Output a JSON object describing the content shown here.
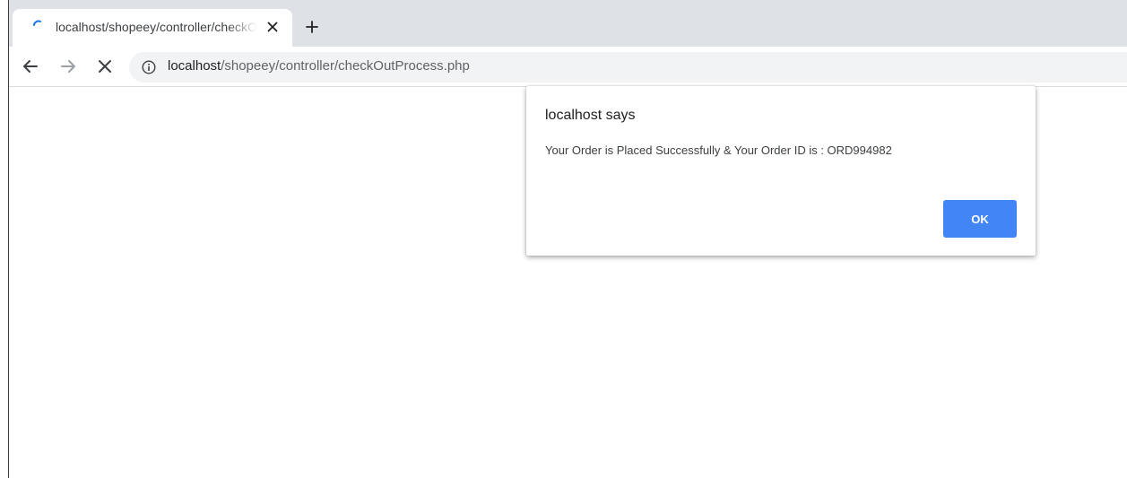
{
  "tab": {
    "title": "localhost/shopeey/controller/checkOutProcess.php",
    "loading": true,
    "close_icon": "close-icon",
    "new_tab_icon": "plus-icon"
  },
  "toolbar": {
    "back_icon": "arrow-left-icon",
    "forward_icon": "arrow-right-icon",
    "stop_icon": "close-icon",
    "info_icon": "info-icon",
    "url_host": "localhost",
    "url_path": "/shopeey/controller/checkOutProcess.php"
  },
  "dialog": {
    "title": "localhost says",
    "message": "Your Order is Placed Successfully & Your Order ID is : ORD994982",
    "ok_label": "OK",
    "accent_color": "#4285f4"
  }
}
